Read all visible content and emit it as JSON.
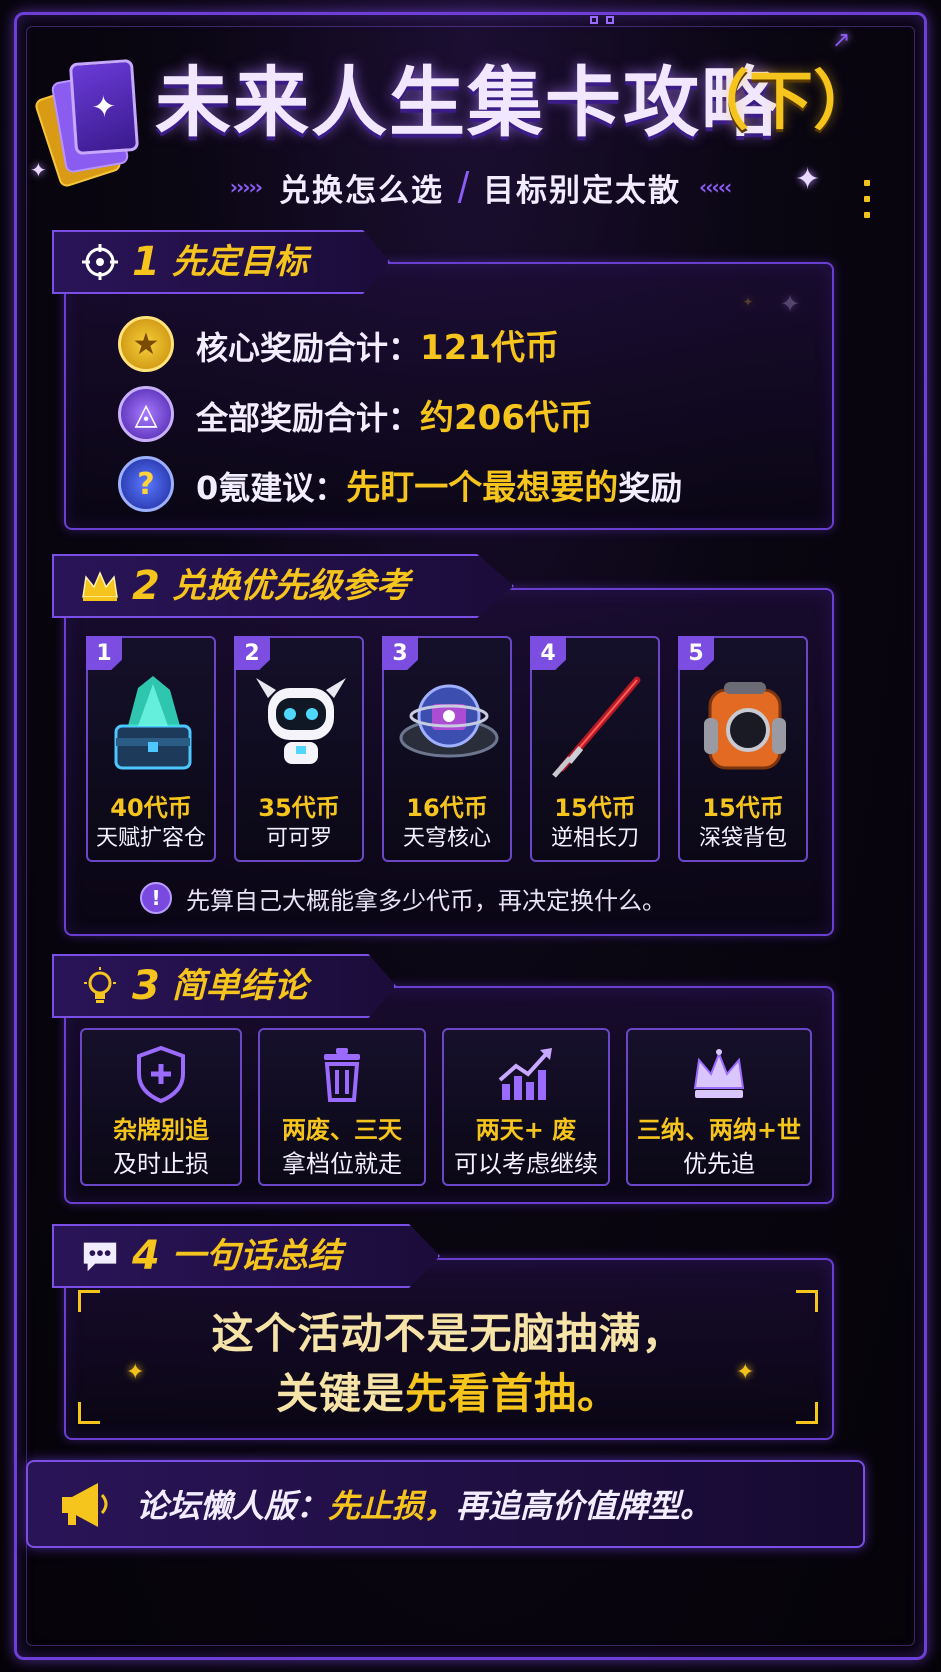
{
  "header": {
    "title": "未来人生集卡攻略",
    "title_suffix": "（下）",
    "subtitle_left": "兑换怎么选",
    "subtitle_right": "目标别定太散"
  },
  "section1": {
    "number": "1",
    "title": "先定目标",
    "rows": [
      {
        "label": "核心奖励合计：",
        "value": "121代币",
        "tail": "",
        "icon": "star-coin-icon"
      },
      {
        "label": "全部奖励合计：",
        "value": "约206代币",
        "tail": "",
        "icon": "ring-coin-icon"
      },
      {
        "label": "0氪建议：",
        "value": "先盯一个最想要的",
        "tail": "奖励",
        "icon": "question-icon"
      }
    ]
  },
  "section2": {
    "number": "2",
    "title": "兑换优先级参考",
    "rewards": [
      {
        "rank": "1",
        "price": "40代币",
        "name": "天赋扩容仓",
        "icon": "crystal-chest-icon"
      },
      {
        "rank": "2",
        "price": "35代币",
        "name": "可可罗",
        "icon": "robot-icon"
      },
      {
        "rank": "3",
        "price": "16代币",
        "name": "天穹核心",
        "icon": "core-orb-icon"
      },
      {
        "rank": "4",
        "price": "15代币",
        "name": "逆相长刀",
        "icon": "blade-icon"
      },
      {
        "rank": "5",
        "price": "15代币",
        "name": "深袋背包",
        "icon": "backpack-icon"
      }
    ],
    "tip": "先算自己大概能拿多少代币，再决定换什么。"
  },
  "section3": {
    "number": "3",
    "title": "简单结论",
    "conclusions": [
      {
        "line1": "杂牌别追",
        "line2": "及时止损",
        "icon": "shield-plus-icon"
      },
      {
        "line1": "两废、三天",
        "line2": "拿档位就走",
        "icon": "trash-icon"
      },
      {
        "line1": "两天+ 废",
        "line2": "可以考虑继续",
        "icon": "trend-up-icon"
      },
      {
        "line1": "三纳、两纳+世",
        "line2": "优先追",
        "icon": "crown-icon"
      }
    ]
  },
  "section4": {
    "number": "4",
    "title": "一句话总结",
    "quote_line1": "这个活动不是无脑抽满，",
    "quote_line2a": "关键是",
    "quote_line2b": "先看首抽。"
  },
  "footer": {
    "prefix": "论坛懒人版：",
    "highlight": "先止损，",
    "suffix": "再追高价值牌型。"
  },
  "colors": {
    "accent_purple": "#7b4fe6",
    "accent_gold": "#f5c41d",
    "background": "#07050d"
  }
}
